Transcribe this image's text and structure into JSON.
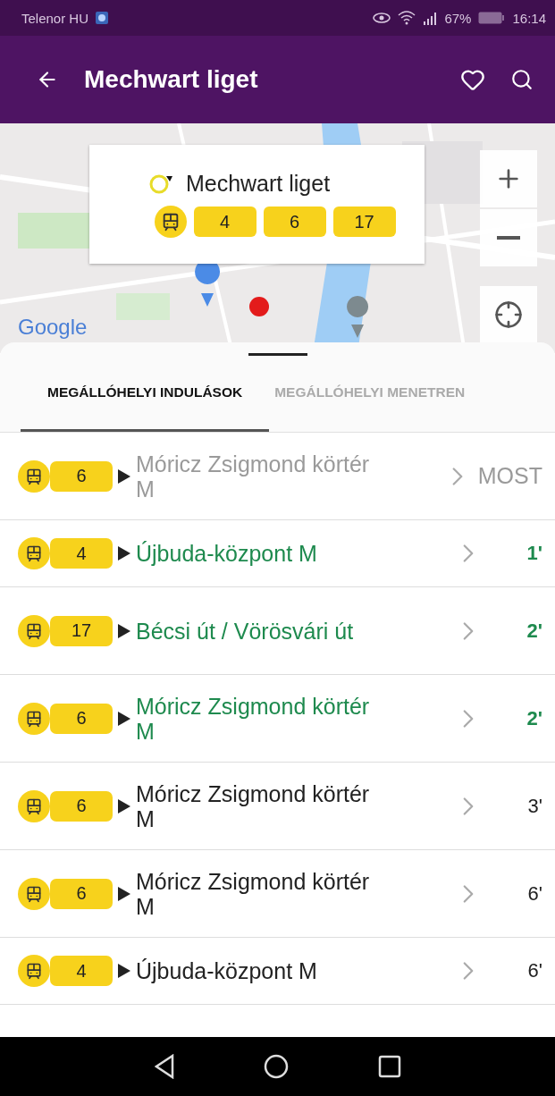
{
  "status_bar": {
    "carrier": "Telenor HU",
    "battery": "67%",
    "time": "16:14"
  },
  "app_bar": {
    "title": "Mechwart liget"
  },
  "map": {
    "attribution": "Google",
    "callout": {
      "stop_name": "Mechwart liget",
      "routes": [
        "4",
        "6",
        "17"
      ]
    }
  },
  "tabs": [
    {
      "label": "MEGÁLLÓHELYI INDULÁSOK",
      "selected": true
    },
    {
      "label": "MEGÁLLÓHELYI MENETREN",
      "selected": false
    }
  ],
  "departures": [
    {
      "route": "6",
      "destination": "Móricz Zsigmond körtér M",
      "time": "MOST",
      "kind": "now"
    },
    {
      "route": "4",
      "destination": "Újbuda-központ M",
      "time": "1'",
      "kind": "live"
    },
    {
      "route": "17",
      "destination": "Bécsi út / Vörösvári út",
      "time": "2'",
      "kind": "live"
    },
    {
      "route": "6",
      "destination": "Móricz Zsigmond körtér M",
      "time": "2'",
      "kind": "live"
    },
    {
      "route": "6",
      "destination": "Móricz Zsigmond körtér M",
      "time": "3'",
      "kind": "scheduled"
    },
    {
      "route": "6",
      "destination": "Móricz Zsigmond körtér M",
      "time": "6'",
      "kind": "scheduled"
    },
    {
      "route": "4",
      "destination": "Újbuda-központ M",
      "time": "6'",
      "kind": "scheduled"
    }
  ]
}
